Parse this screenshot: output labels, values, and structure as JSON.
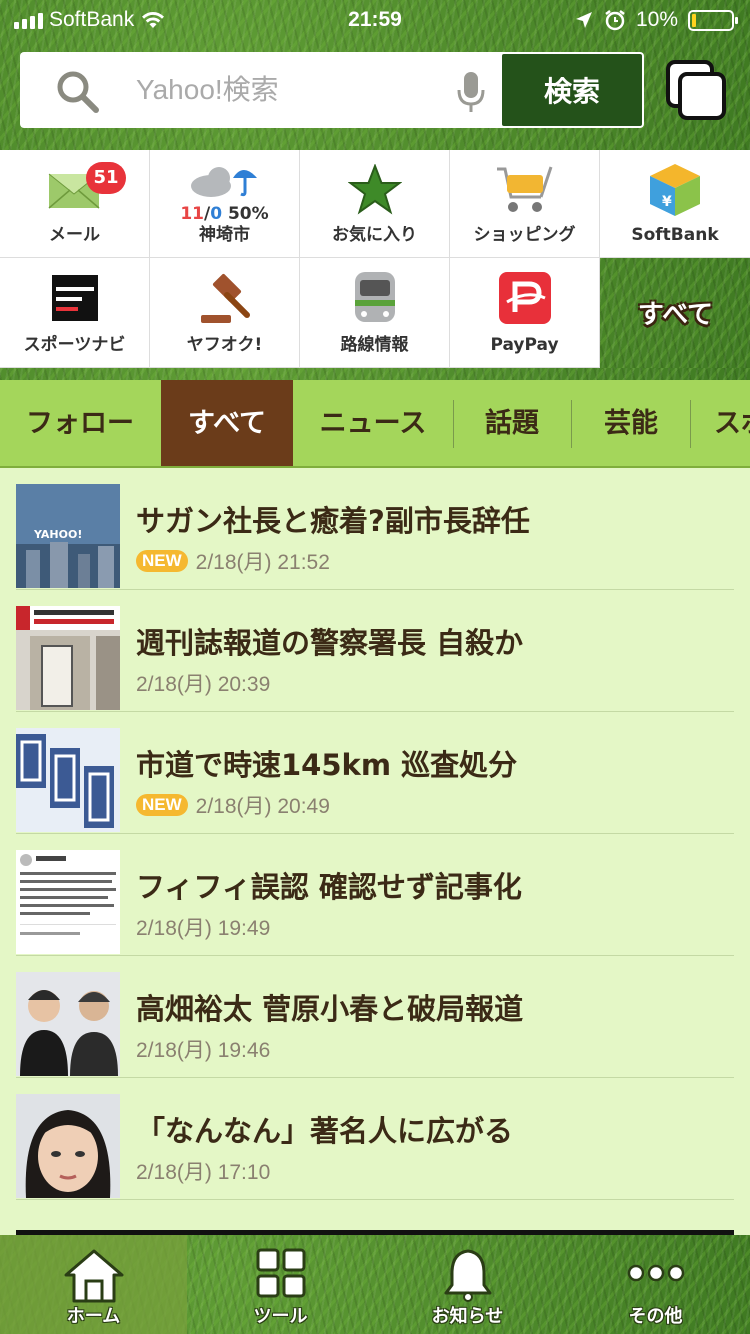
{
  "status_bar": {
    "carrier": "SoftBank",
    "time": "21:59",
    "battery_pct": "10%",
    "battery_level": 0.1
  },
  "search": {
    "placeholder": "Yahoo!検索",
    "button_label": "検索"
  },
  "tools": [
    {
      "label": "メール",
      "icon": "mail-icon",
      "badge": "51"
    },
    {
      "label": "神埼市",
      "icon": "weather-icon",
      "temp_high": "11",
      "temp_sep": "/",
      "temp_low": "0",
      "rain": "50%"
    },
    {
      "label": "お気に入り",
      "icon": "star-icon"
    },
    {
      "label": "ショッピング",
      "icon": "cart-icon"
    },
    {
      "label": "SoftBank",
      "icon": "softbank-cube-icon"
    },
    {
      "label": "スポーツナビ",
      "icon": "sportsnavi-logo-icon"
    },
    {
      "label": "ヤフオク!",
      "icon": "gavel-icon"
    },
    {
      "label": "路線情報",
      "icon": "train-icon"
    },
    {
      "label": "PayPay",
      "icon": "paypay-icon"
    }
  ],
  "tool_all_label": "すべて",
  "categories": [
    "フォロー",
    "すべて",
    "ニュース",
    "話題",
    "芸能",
    "スポ"
  ],
  "active_category": "すべて",
  "news": [
    {
      "title": "サガン社長と癒着?副市長辞任",
      "date": "2/18(月) 21:52",
      "is_new": true,
      "new_label": "NEW",
      "thumb": "yahoo-news-thumb"
    },
    {
      "title": "週刊誌報道の警察署長 自殺か",
      "date": "2/18(月) 20:39",
      "is_new": false,
      "thumb": "police-building-thumb"
    },
    {
      "title": "市道で時速145km 巡査処分",
      "date": "2/18(月) 20:49",
      "is_new": true,
      "new_label": "NEW",
      "thumb": "police-sign-thumb"
    },
    {
      "title": "フィフィ誤認 確認せず記事化",
      "date": "2/18(月) 19:49",
      "is_new": false,
      "thumb": "tweet-thumb"
    },
    {
      "title": "高畑裕太 菅原小春と破局報道",
      "date": "2/18(月) 19:46",
      "is_new": false,
      "thumb": "couple-thumb"
    },
    {
      "title": "「なんなん」著名人に広がる",
      "date": "2/18(月) 17:10",
      "is_new": false,
      "thumb": "portrait-thumb"
    }
  ],
  "bottom_nav": [
    {
      "label": "ホーム",
      "icon": "home-icon",
      "active": true
    },
    {
      "label": "ツール",
      "icon": "tools-grid-icon",
      "active": false
    },
    {
      "label": "お知らせ",
      "icon": "bell-icon",
      "active": false
    },
    {
      "label": "その他",
      "icon": "more-dots-icon",
      "active": false
    }
  ],
  "colors": {
    "header_grass": "#4e8a2c",
    "search_button": "#24521a",
    "category_bar": "#a4d65b",
    "active_tab": "#6b3c1a",
    "list_bg": "#e4f7c6",
    "new_badge": "#f5b830",
    "mail_badge": "#e8333a"
  }
}
